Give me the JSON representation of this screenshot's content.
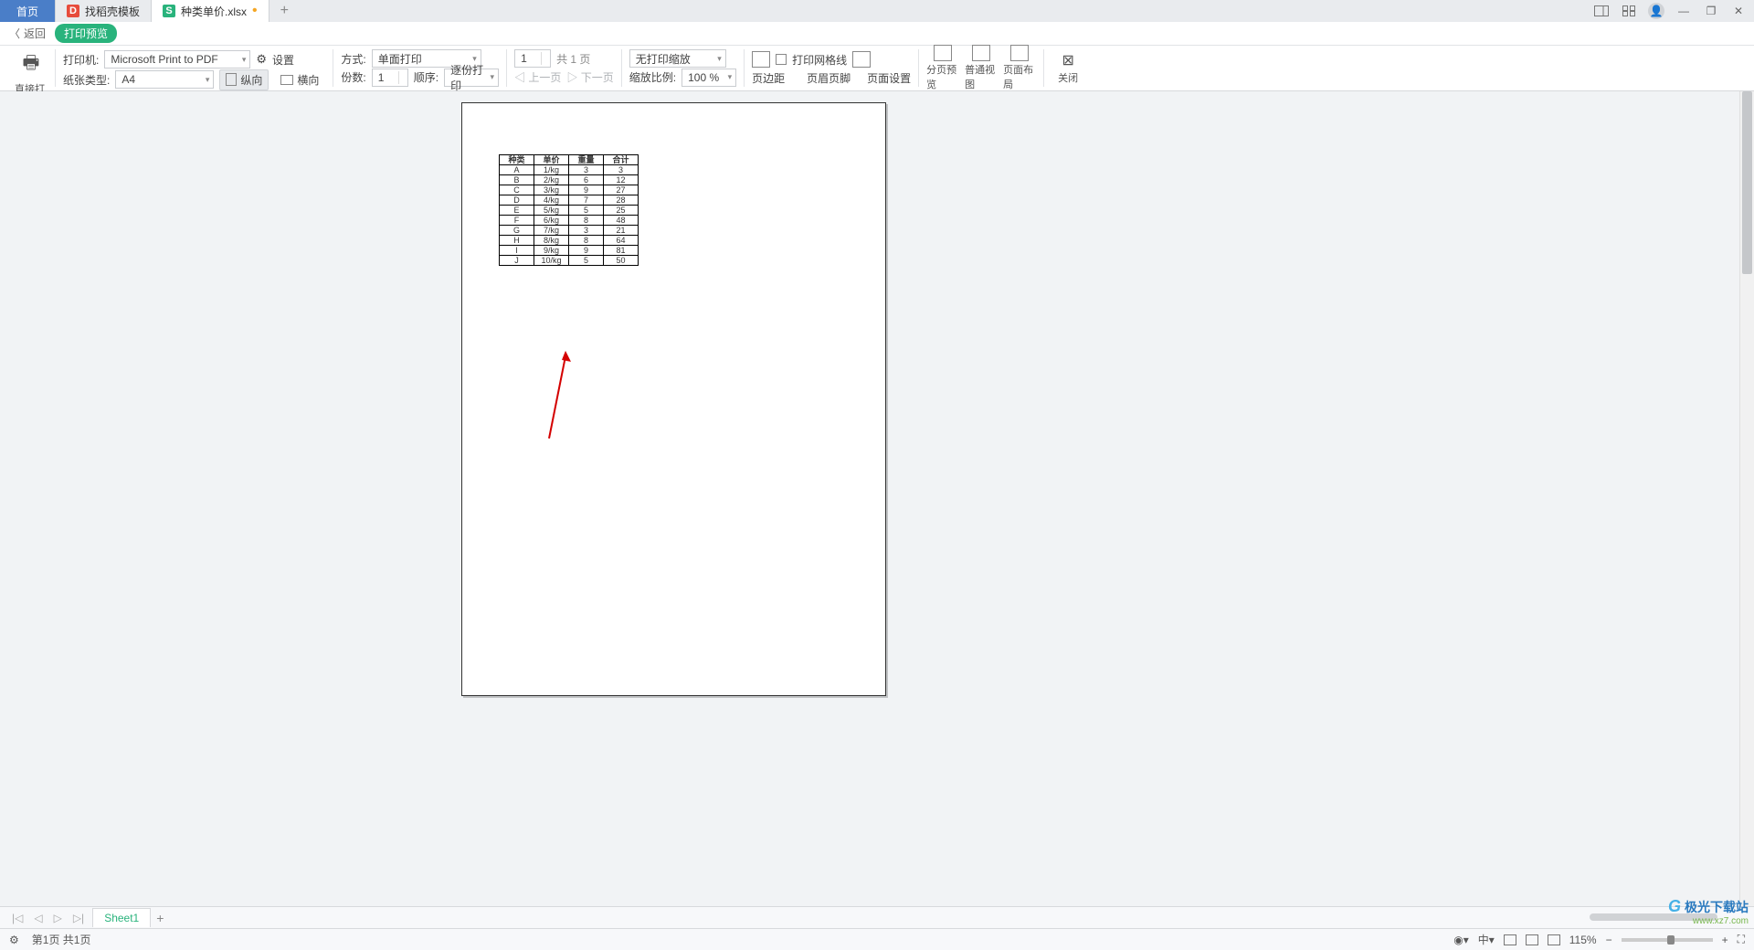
{
  "tabs": {
    "home": "首页",
    "template": "找稻壳模板",
    "file": "种类单价.xlsx"
  },
  "subheader": {
    "back": "返回",
    "title": "打印预览"
  },
  "toolbar": {
    "direct_print": "直接打印",
    "printer_lbl": "打印机:",
    "printer_val": "Microsoft Print to PDF",
    "paper_lbl": "纸张类型:",
    "paper_val": "A4",
    "settings": "设置",
    "portrait": "纵向",
    "landscape": "横向",
    "mode_lbl": "方式:",
    "mode_val": "单面打印",
    "copies_lbl": "份数:",
    "copies_val": "1",
    "order_lbl": "顺序:",
    "order_val": "逐份打印",
    "page_val": "1",
    "page_total": "共 1 页",
    "prev": "上一页",
    "next": "下一页",
    "scale_mode": "无打印缩放",
    "scale_lbl": "缩放比例:",
    "scale_val": "100 %",
    "margins": "页边距",
    "gridlines": "打印网格线",
    "header_footer": "页眉页脚",
    "page_setup": "页面设置",
    "page_break": "分页预览",
    "normal_view": "普通视图",
    "page_layout": "页面布局",
    "close": "关闭"
  },
  "table": {
    "headers": [
      "种类",
      "单价",
      "重量",
      "合计"
    ],
    "rows": [
      [
        "A",
        "1/kg",
        "3",
        "3"
      ],
      [
        "B",
        "2/kg",
        "6",
        "12"
      ],
      [
        "C",
        "3/kg",
        "9",
        "27"
      ],
      [
        "D",
        "4/kg",
        "7",
        "28"
      ],
      [
        "E",
        "5/kg",
        "5",
        "25"
      ],
      [
        "F",
        "6/kg",
        "8",
        "48"
      ],
      [
        "G",
        "7/kg",
        "3",
        "21"
      ],
      [
        "H",
        "8/kg",
        "8",
        "64"
      ],
      [
        "I",
        "9/kg",
        "9",
        "81"
      ],
      [
        "J",
        "10/kg",
        "5",
        "50"
      ]
    ]
  },
  "sheet": {
    "name": "Sheet1"
  },
  "status": {
    "page_info": "第1页 共1页",
    "zoom": "115%"
  },
  "watermark": {
    "text": "极光下载站",
    "url": "www.xz7.com"
  }
}
